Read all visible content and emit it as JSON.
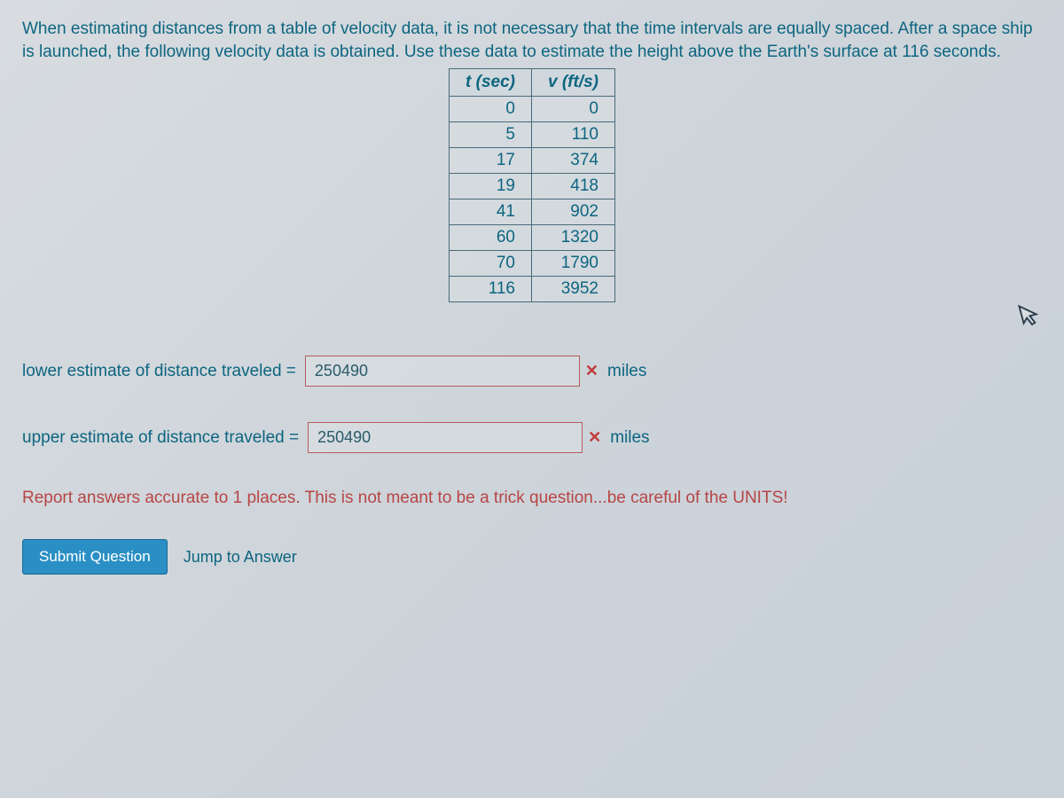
{
  "problem": {
    "text": "When estimating distances from a table of velocity data, it is not necessary that the time intervals are equally spaced. After a space ship is launched, the following velocity data is obtained. Use these data to estimate the height above the Earth's surface at 116 seconds."
  },
  "table": {
    "headers": {
      "t": "t (sec)",
      "v": "v (ft/s)"
    },
    "rows": [
      {
        "t": "0",
        "v": "0"
      },
      {
        "t": "5",
        "v": "110"
      },
      {
        "t": "17",
        "v": "374"
      },
      {
        "t": "19",
        "v": "418"
      },
      {
        "t": "41",
        "v": "902"
      },
      {
        "t": "60",
        "v": "1320"
      },
      {
        "t": "70",
        "v": "1790"
      },
      {
        "t": "116",
        "v": "3952"
      }
    ]
  },
  "answers": {
    "lower_label": "lower estimate of distance traveled =",
    "lower_value": "250490",
    "upper_label": "upper estimate of distance traveled =",
    "upper_value": "250490",
    "units": "miles",
    "wrong_mark": "✕"
  },
  "hint": "Report answers accurate to 1 places. This is not meant to be a trick question...be careful of the UNITS!",
  "buttons": {
    "submit": "Submit Question",
    "jump": "Jump to Answer"
  },
  "cursor_glyph": "↖"
}
